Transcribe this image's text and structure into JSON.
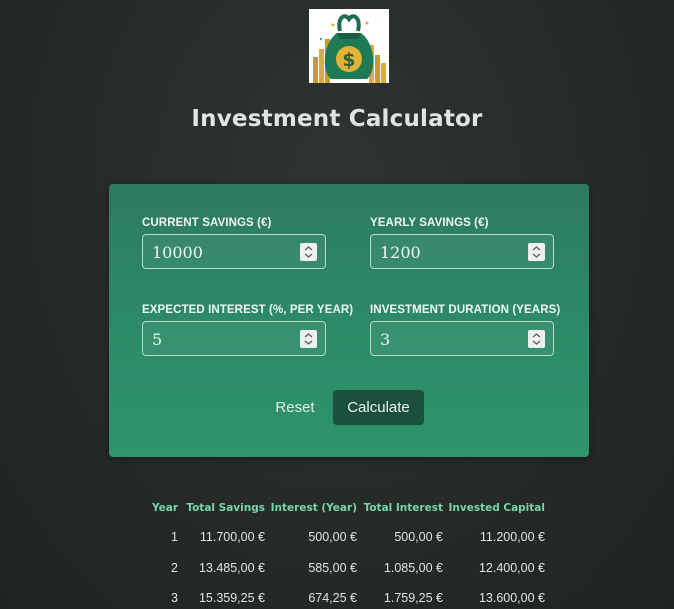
{
  "logo": {
    "icon": "money-bag-icon",
    "glyph": "$"
  },
  "title": "Investment Calculator",
  "form": {
    "current_savings": {
      "label": "CURRENT SAVINGS (€)",
      "value": "10000"
    },
    "yearly_savings": {
      "label": "YEARLY SAVINGS (€)",
      "value": "1200"
    },
    "expected_interest": {
      "label": "EXPECTED INTEREST (%, PER YEAR)",
      "value": "5"
    },
    "duration": {
      "label": "INVESTMENT DURATION (YEARS)",
      "value": "3"
    },
    "reset_label": "Reset",
    "calculate_label": "Calculate"
  },
  "table": {
    "headers": [
      "Year",
      "Total Savings",
      "Interest (Year)",
      "Total Interest",
      "Invested Capital"
    ],
    "rows": [
      [
        "1",
        "11.700,00 €",
        "500,00 €",
        "500,00 €",
        "11.200,00 €"
      ],
      [
        "2",
        "13.485,00 €",
        "585,00 €",
        "1.085,00 €",
        "12.400,00 €"
      ],
      [
        "3",
        "15.359,25 €",
        "674,25 €",
        "1.759,25 €",
        "13.600,00 €"
      ]
    ]
  },
  "colors": {
    "background": "#262a28",
    "card": "#2c8a68",
    "calculate_button": "#1c4f40",
    "table_header": "#78d6a8"
  }
}
